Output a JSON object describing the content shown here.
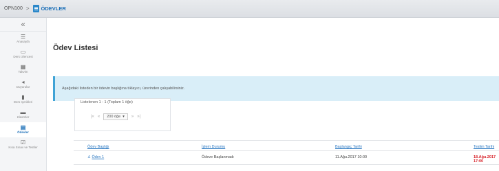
{
  "breadcrumb": {
    "root": "OPN100",
    "separator": ">",
    "current": "ÖDEVLER"
  },
  "sidebar": {
    "collapse": "«",
    "items": [
      {
        "label": "Anasayfa",
        "icon": "list-icon"
      },
      {
        "label": "Ders Izlencesi",
        "icon": "book-open-icon"
      },
      {
        "label": "Takvim",
        "icon": "calendar-icon"
      },
      {
        "label": "Duyurular",
        "icon": "megaphone-icon"
      },
      {
        "label": "Ders Içerikleri",
        "icon": "folder-icon"
      },
      {
        "label": "Klasörler",
        "icon": "folder-icon"
      },
      {
        "label": "Ödevler",
        "icon": "document-icon",
        "active": true
      },
      {
        "label": "Kısa Sınav ve Testler",
        "icon": "checkbox-icon"
      }
    ]
  },
  "main": {
    "title": "Ödev Listesi",
    "info_text": "Aşağıdaki listeden bir ödevin başlığına tıklayıcı, üzerinden çalışabilirsiniz.",
    "pager": {
      "summary": "Listelenen 1 - 1 (Toplam 1 öğe)",
      "first": "|«",
      "prev": "«",
      "page_size": "200 öğe",
      "next": "»",
      "last": "»|"
    },
    "table": {
      "headers": [
        "Ödev Başlığı",
        "İşlem Durumu",
        "Başlangıç Tarihi",
        "Teslim Tarihi"
      ],
      "rows": [
        {
          "title": "Ödev 1",
          "status": "Ödeve Başlanmadı",
          "start": "11.Ağu.2017 10:00",
          "due": "18.Ağu.2017 17:00"
        }
      ]
    }
  }
}
